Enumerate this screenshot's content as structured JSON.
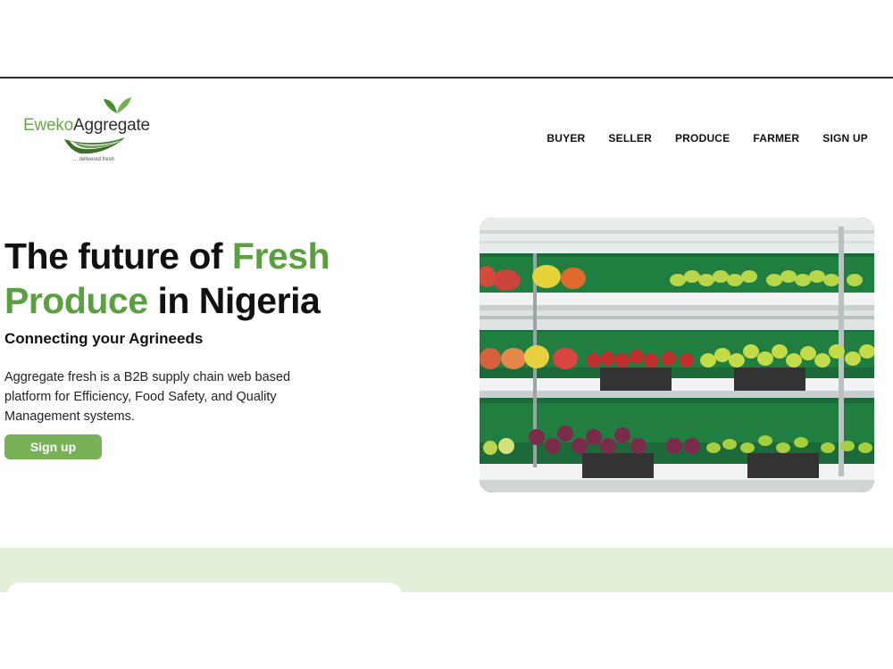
{
  "brand": {
    "name_part1": "Eweko",
    "name_part2": "Aggregate",
    "tagline": "... delivered fresh",
    "logo_icon": "leaf-icon",
    "colors": {
      "green": "#6aa84f",
      "dark": "#2e2e2e"
    }
  },
  "nav": {
    "items": [
      {
        "label": "BUYER"
      },
      {
        "label": "SELLER"
      },
      {
        "label": "PRODUCE"
      },
      {
        "label": "FARMER"
      },
      {
        "label": "SIGN UP"
      }
    ]
  },
  "hero": {
    "title_part1": "The future of ",
    "title_green1": "Fresh",
    "title_green2": "Produce",
    "title_part2": " in Nigeria",
    "subtitle": "Connecting your Agrineeds",
    "description": "Aggregate fresh is a B2B supply chain web based platform for Efficiency, Food Safety, and Quality Management systems.",
    "cta_label": "Sign up",
    "image_alt": "supermarket shelves with fresh vegetables",
    "colors": {
      "accent": "#5aa040",
      "button": "#79b159"
    }
  },
  "section": {
    "band_color": "#e3efd8"
  }
}
